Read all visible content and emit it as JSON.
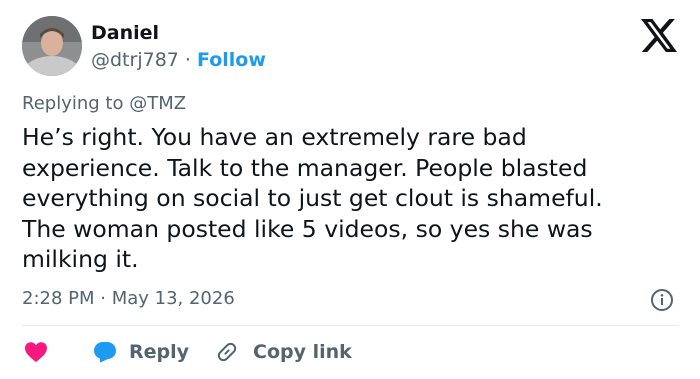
{
  "author": {
    "name": "Daniel",
    "handle": "@dtrj787",
    "separator": "·",
    "follow_label": "Follow"
  },
  "reply_context": "Replying to @TMZ",
  "tweet": {
    "lines": [
      "He’s right. You have an extremely rare bad",
      "experience. Talk to the manager. People blasted",
      "everything on social to just get clout is shameful.",
      "The woman posted like 5 videos, so yes she was",
      "milking it."
    ]
  },
  "timestamp": "2:28 PM · May 13, 2026",
  "actions": {
    "reply_label": "Reply",
    "copy_link_label": "Copy link"
  },
  "icons": {
    "logo": "x-logo-icon",
    "info": "info-icon",
    "like": "heart-icon",
    "reply": "reply-bubble-icon",
    "copy_link": "link-icon"
  },
  "colors": {
    "accent": "#1d9bf0",
    "like": "#f91880",
    "text": "#0f1419",
    "secondary": "#536471"
  }
}
